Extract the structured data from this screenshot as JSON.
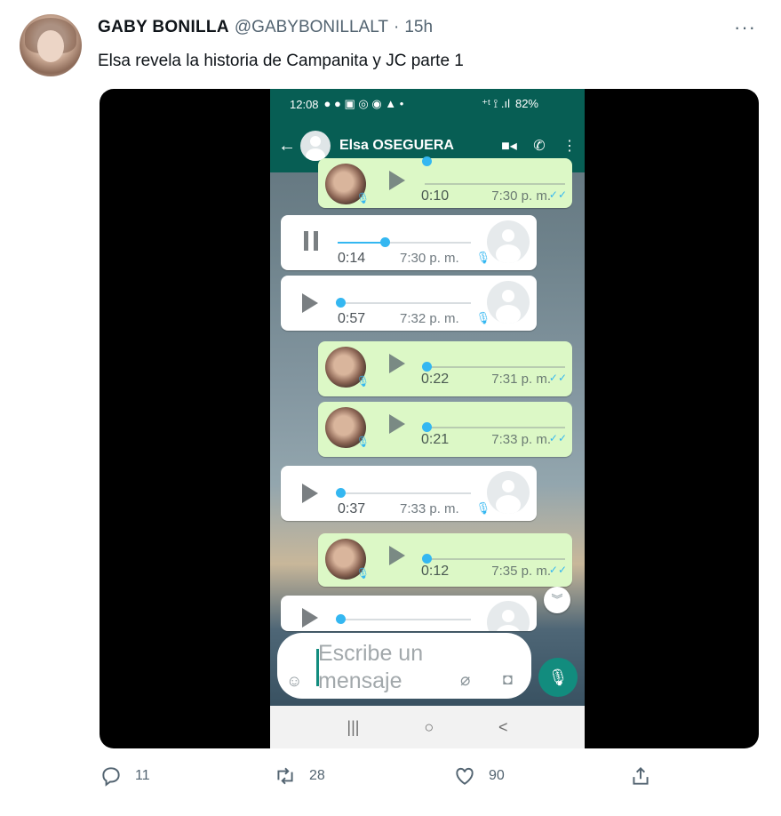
{
  "tweet": {
    "author_name": "GABY BONILLA",
    "handle": "@GABYBONILLALT",
    "separator": "·",
    "time": "15h",
    "more_label": "···",
    "text": "Elsa revela la historia de Campanita y JC parte 1"
  },
  "media": {
    "status_bar": {
      "time": "12:08",
      "left_icons": "● ● ▣ ◎ ◉ ▲ •",
      "right_icons": "⁺ᵗ ⟟ .ıl",
      "battery": "82%"
    },
    "chat": {
      "back_icon": "arrow-left-icon",
      "contact_name": "Elsa OSEGUERA",
      "messages": [
        {
          "direction": "out",
          "duration": "0:10",
          "time": "7:30 p. m."
        },
        {
          "direction": "in",
          "state": "playing",
          "progress": 0.33,
          "duration": "0:14",
          "time": "7:30 p. m."
        },
        {
          "direction": "in",
          "state": "paused",
          "duration": "0:57",
          "time": "7:32 p. m."
        },
        {
          "direction": "out",
          "duration": "0:22",
          "time": "7:31 p. m."
        },
        {
          "direction": "out",
          "duration": "0:21",
          "time": "7:33 p. m."
        },
        {
          "direction": "in",
          "state": "paused",
          "duration": "0:37",
          "time": "7:33 p. m."
        },
        {
          "direction": "out",
          "duration": "0:12",
          "time": "7:35 p. m."
        },
        {
          "direction": "in",
          "state": "paused",
          "duration": "",
          "time": ""
        }
      ],
      "input_placeholder": "Escribe un mensaje",
      "nav": [
        "|||",
        "○",
        "<"
      ]
    },
    "colors": {
      "whatsapp_header": "#075e54",
      "outgoing_bubble": "#dcf8c6",
      "accent": "#34b7f1"
    }
  },
  "actions": {
    "reply_count": "11",
    "retweet_count": "28",
    "like_count": "90"
  }
}
